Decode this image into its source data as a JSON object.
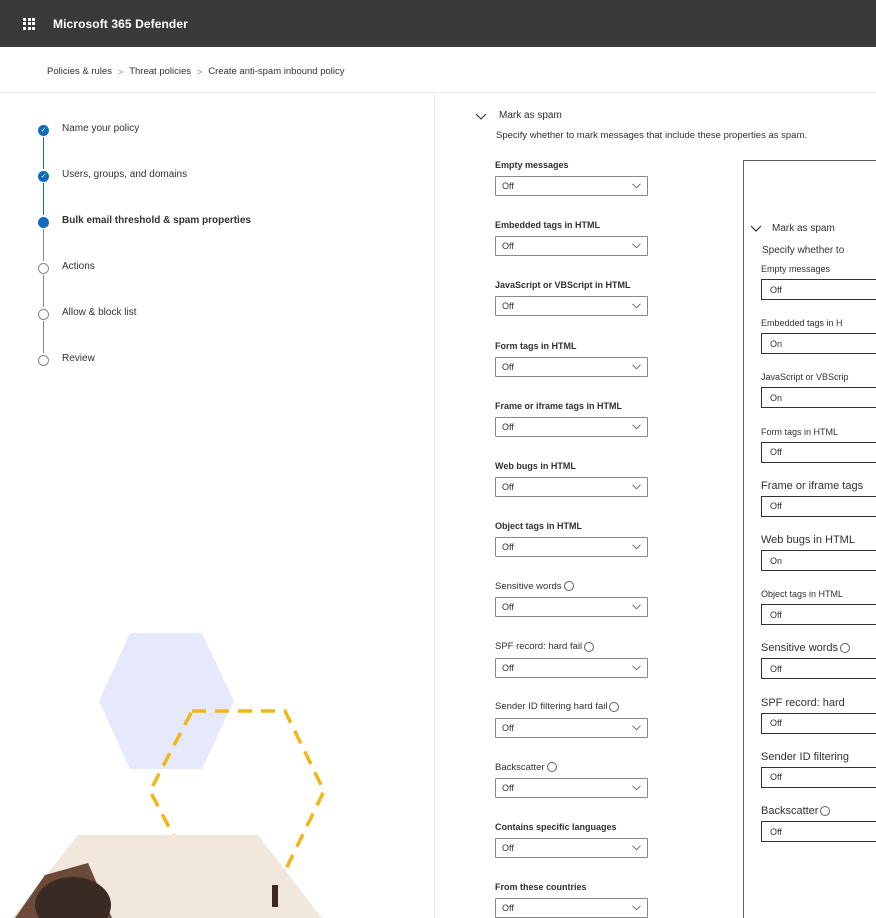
{
  "app": {
    "title": "Microsoft 365 Defender"
  },
  "breadcrumb": [
    "Policies & rules",
    "Threat policies",
    "Create anti-spam inbound policy"
  ],
  "steps": [
    {
      "label": "Name your policy",
      "state": "done"
    },
    {
      "label": "Users, groups, and domains",
      "state": "done"
    },
    {
      "label": "Bulk email threshold & spam properties",
      "state": "current"
    },
    {
      "label": "Actions",
      "state": "todo"
    },
    {
      "label": "Allow & block list",
      "state": "todo"
    },
    {
      "label": "Review",
      "state": "todo"
    }
  ],
  "section": {
    "title": "Mark as spam",
    "description": "Specify whether to mark messages that include these properties as spam."
  },
  "fields": [
    {
      "label": "Empty messages",
      "value": "Off",
      "info": false
    },
    {
      "label": "Embedded tags in HTML",
      "value": "Off",
      "info": false
    },
    {
      "label": "JavaScript or VBScript in HTML",
      "value": "Off",
      "info": false
    },
    {
      "label": "Form tags in HTML",
      "value": "Off",
      "info": false
    },
    {
      "label": "Frame or iframe tags in HTML",
      "value": "Off",
      "info": false
    },
    {
      "label": "Web bugs in HTML",
      "value": "Off",
      "info": false
    },
    {
      "label": "Object tags in HTML",
      "value": "Off",
      "info": false
    },
    {
      "label": "Sensitive words",
      "value": "Off",
      "info": true
    },
    {
      "label": "SPF record: hard fail",
      "value": "Off",
      "info": true
    },
    {
      "label": "Sender ID filtering hard fail",
      "value": "Off",
      "info": true
    },
    {
      "label": "Backscatter",
      "value": "Off",
      "info": true
    },
    {
      "label": "Contains specific languages",
      "value": "Off",
      "info": false
    },
    {
      "label": "From these countries",
      "value": "Off",
      "info": false
    }
  ],
  "zoom": {
    "title": "Mark as spam",
    "description": "Specify whether to",
    "fields": [
      {
        "label": "Empty messages",
        "value": "Off"
      },
      {
        "label": "Embedded tags in H",
        "value": "On"
      },
      {
        "label": "JavaScript or VBScrip",
        "value": "On"
      },
      {
        "label": "Form tags in HTML",
        "value": "Off"
      },
      {
        "label": "Frame or iframe tags",
        "value": "Off"
      },
      {
        "label": "Web bugs in HTML",
        "value": "On"
      },
      {
        "label": "Object tags in HTML",
        "value": "Off"
      },
      {
        "label": "Sensitive words",
        "value": "Off"
      },
      {
        "label": "SPF record: hard",
        "value": "Off"
      },
      {
        "label": "Sender ID filtering",
        "value": "Off"
      },
      {
        "label": "Backscatter",
        "value": "Off"
      }
    ]
  },
  "colors": {
    "topbar": "#3b3a39",
    "accent": "#0f6cbd",
    "hexagon_fill": "#e5e9fb",
    "hexagon_dashed": "#f2b619"
  }
}
